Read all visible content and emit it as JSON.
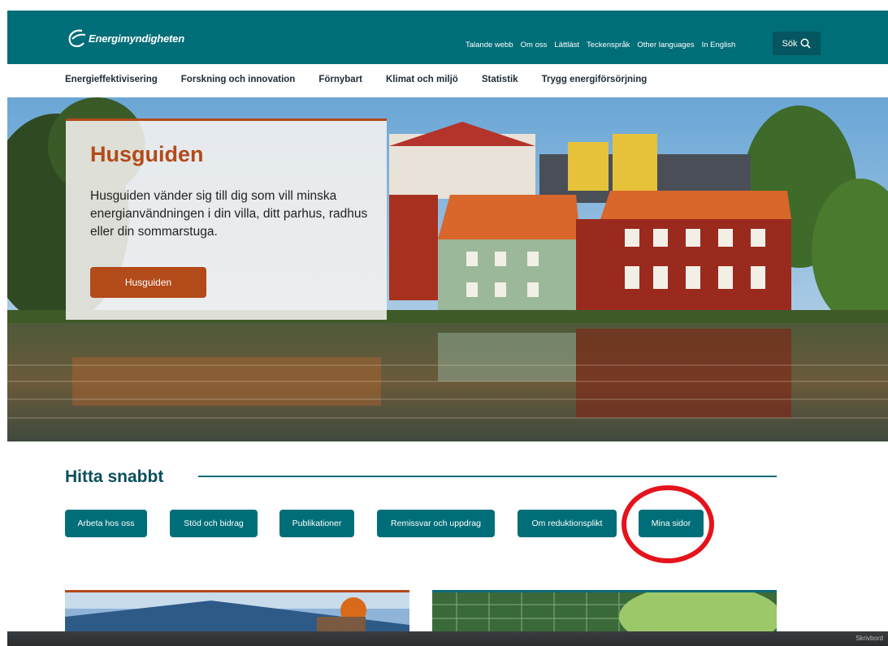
{
  "site": {
    "logo_text": "Energimyndigheten"
  },
  "toplinks": [
    "Talande webb",
    "Om oss",
    "Lättläst",
    "Teckenspråk",
    "Other languages",
    "In English"
  ],
  "search": {
    "label": "Sök"
  },
  "mainnav": [
    "Energieffektivisering",
    "Forskning och innovation",
    "Förnybart",
    "Klimat och miljö",
    "Statistik",
    "Trygg energiförsörjning"
  ],
  "hero": {
    "title": "Husguiden",
    "text": "Husguiden vänder sig till dig som vill minska energianvändningen i din villa, ditt parhus, radhus eller din sommarstuga.",
    "button": "Husguiden"
  },
  "quick": {
    "title": "Hitta snabbt",
    "buttons": [
      "Arbeta hos oss",
      "Stöd och bidrag",
      "Publikationer",
      "Remissvar och uppdrag",
      "Om reduktionsplikt",
      "Mina sidor"
    ]
  },
  "taskbar": {
    "text": "Skrivbord"
  },
  "colors": {
    "brand": "#006e78",
    "accent": "#b34a1a",
    "highlight": "#e5131b"
  }
}
